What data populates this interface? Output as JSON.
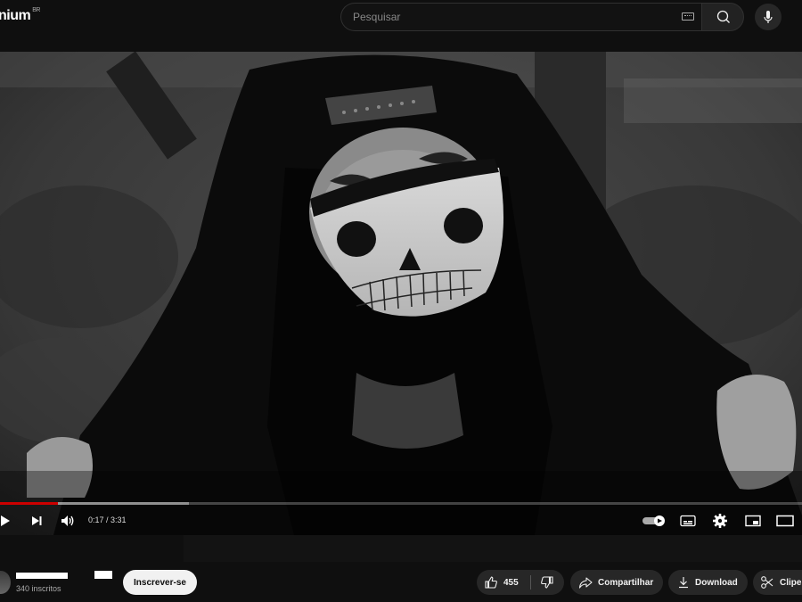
{
  "header": {
    "logo_text": "nium",
    "logo_country": "BR",
    "search_placeholder": "Pesquisar"
  },
  "player": {
    "current_time": "0:17",
    "duration": "3:31",
    "time_separator": " / ",
    "played_fraction": 0.072,
    "loaded_fraction": 0.235,
    "accent_color": "#cc0000"
  },
  "channel": {
    "subscribers": "340 inscritos",
    "subscribe_label": "Inscrever-se"
  },
  "actions": {
    "like_count": "455",
    "share_label": "Compartilhar",
    "download_label": "Download",
    "clip_label": "Clipe"
  }
}
